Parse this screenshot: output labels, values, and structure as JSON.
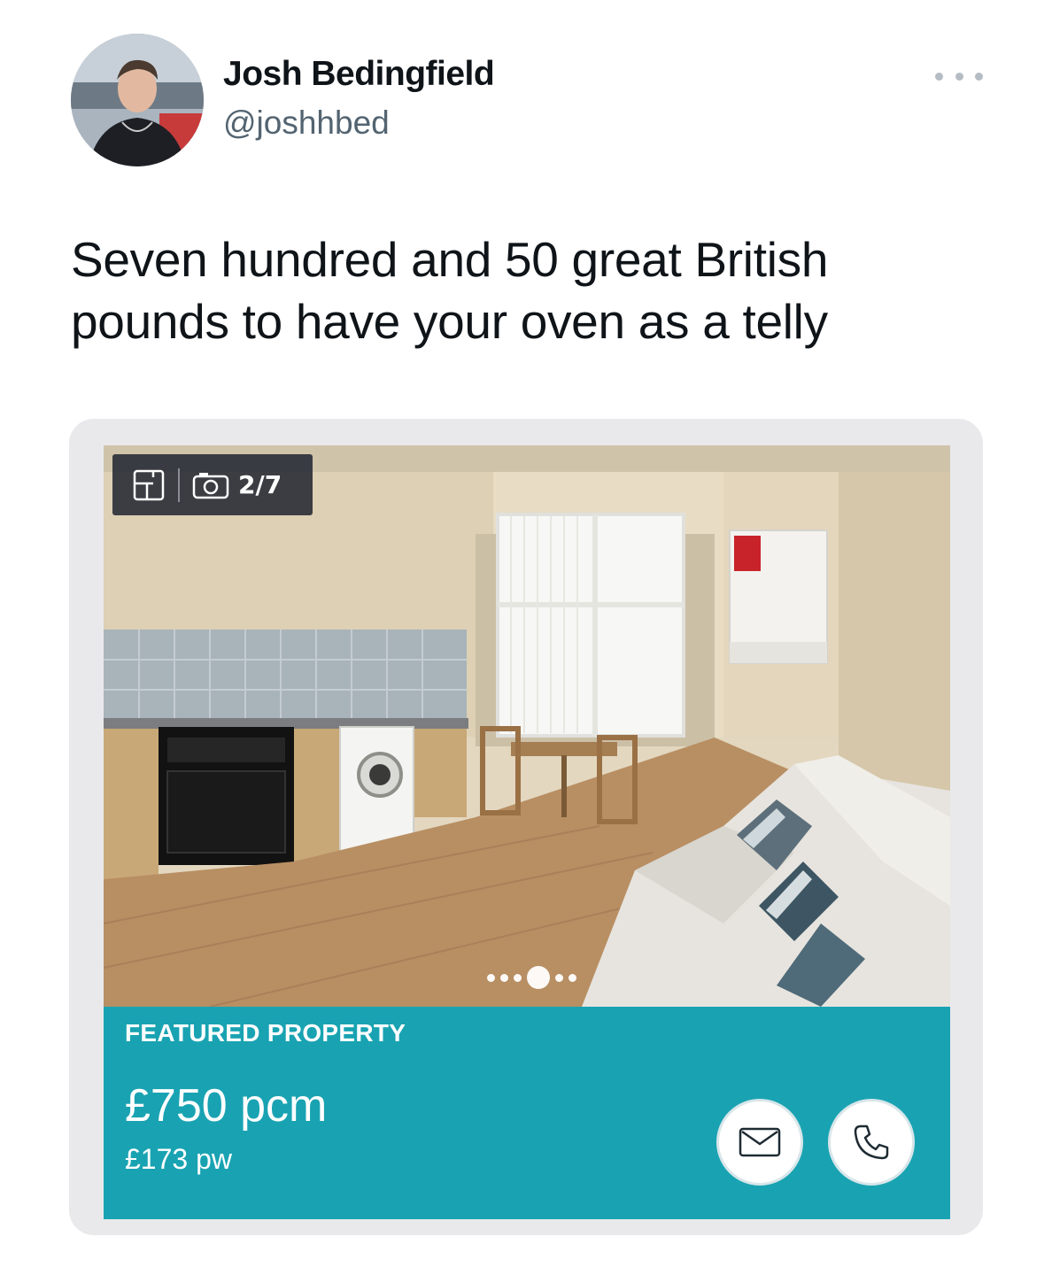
{
  "tweet": {
    "author": {
      "name": "Josh Bedingfield",
      "handle": "@joshhbed"
    },
    "text": "Seven hundred and 50 great British pounds to have your oven as a telly",
    "more_icon": "more-horizontal-icon"
  },
  "listing": {
    "photo_counter": "2/7",
    "carousel": {
      "active_index": 3,
      "dot_count": 6
    },
    "badge": "FEATURED PROPERTY",
    "price_monthly": "£750 pcm",
    "price_weekly": "£173 pw",
    "icons": {
      "floorplan": "floorplan-icon",
      "camera": "camera-icon",
      "email": "envelope-icon",
      "call": "phone-icon"
    },
    "colors": {
      "panel": "#19a3b2",
      "toolbar": "#2d303a"
    }
  }
}
